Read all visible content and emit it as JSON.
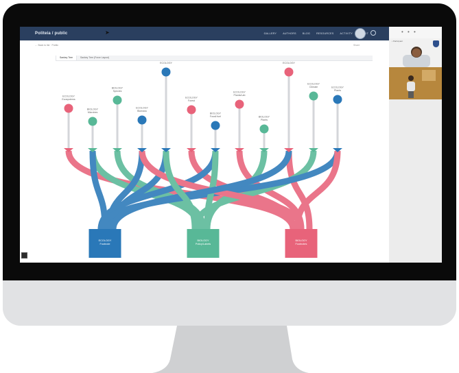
{
  "app": {
    "logo_text": "Politeia / public",
    "nav": [
      "GALLERY",
      "AUTHORS",
      "BLOG",
      "RESOURCES",
      "ACTIVITY",
      "ABOUT"
    ],
    "breadcrumb": "← Back to list · Public",
    "subbar_right": "Share"
  },
  "tabs": [
    "Sankey Tree",
    "Sankey Tree (Force Layout)"
  ],
  "side_panel": {
    "dots": "• • •",
    "video1_label": "• Participant"
  },
  "nodes": [
    {
      "label": "ECOLOGY\nEcosystems",
      "color": "#e8637a"
    },
    {
      "label": "BIOLOGY\nMicrobes",
      "color": "#58b897"
    },
    {
      "label": "BIOLOGY\nSpecies",
      "color": "#58b897"
    },
    {
      "label": "ECOLOGY\nBiomass",
      "color": "#2a78b8"
    },
    {
      "label": "ECOLOGY",
      "color": "#2a78b8"
    },
    {
      "label": "ECOLOGY\nForest",
      "color": "#e8637a"
    },
    {
      "label": "BIOLOGY\nFossil fuel",
      "color": "#2a78b8"
    },
    {
      "label": "ECOLOGY\nPlants/Lab",
      "color": "#e8637a"
    },
    {
      "label": "BIOLOGY\nPlants",
      "color": "#58b897"
    },
    {
      "label": "ECOLOGY",
      "color": "#e8637a"
    },
    {
      "label": "ECOLOGY\nClimate",
      "color": "#58b897"
    },
    {
      "label": "ECOLOGY\nPlants",
      "color": "#2a78b8"
    }
  ],
  "bottom_boxes": [
    {
      "label": "ECOLOGY\nFootnote",
      "color": "#2a78b8"
    },
    {
      "label": "BIOLOGY\nPolicy/Labels",
      "color": "#58b897"
    },
    {
      "label": "BIOLOGY\nFootnotes",
      "color": "#e8637a"
    }
  ]
}
